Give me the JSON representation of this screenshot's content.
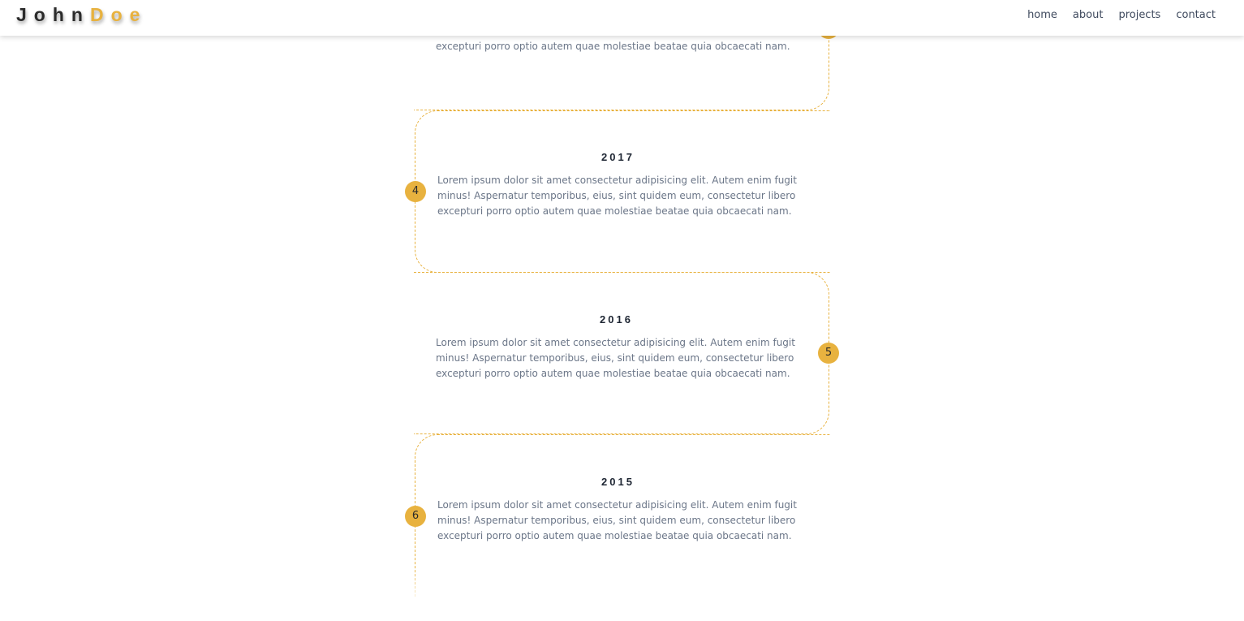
{
  "header": {
    "logo_first": "John",
    "logo_last": "Doe",
    "nav": [
      "home",
      "about",
      "projects",
      "contact"
    ]
  },
  "timeline": {
    "partial_entry": {
      "description_visible": "excepturi porro optio autem quae molestiae beatae quia obcaecati nam."
    },
    "entries": [
      {
        "number": "4",
        "year": "2017",
        "description": "Lorem ipsum dolor sit amet consectetur adipisicing elit. Autem enim fugit minus! Aspernatur temporibus, eius, sint quidem eum, consectetur libero excepturi porro optio autem quae molestiae beatae quia obcaecati nam."
      },
      {
        "number": "5",
        "year": "2016",
        "description": "Lorem ipsum dolor sit amet consectetur adipisicing elit. Autem enim fugit minus! Aspernatur temporibus, eius, sint quidem eum, consectetur libero excepturi porro optio autem quae molestiae beatae quia obcaecati nam."
      },
      {
        "number": "6",
        "year": "2015",
        "description": "Lorem ipsum dolor sit amet consectetur adipisicing elit. Autem enim fugit minus! Aspernatur temporibus, eius, sint quidem eum, consectetur libero excepturi porro optio autem quae molestiae beatae quia obcaecati nam."
      }
    ]
  },
  "colors": {
    "accent": "#e8b23f",
    "text": "#6b7688",
    "heading": "#1e2633"
  }
}
